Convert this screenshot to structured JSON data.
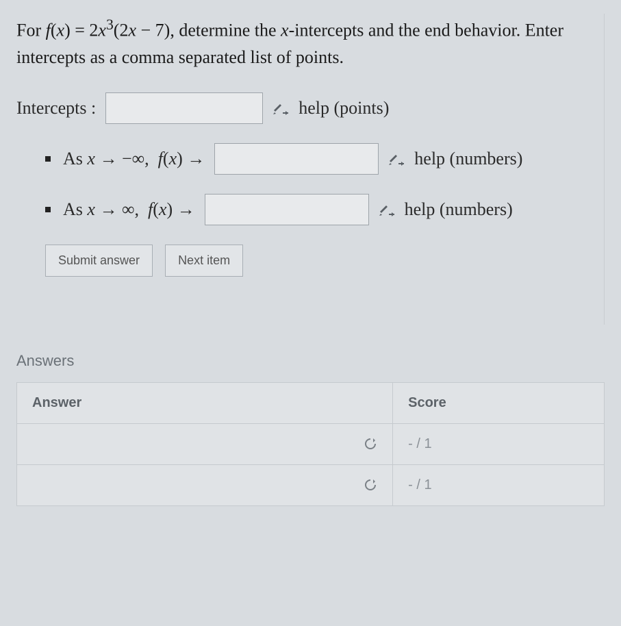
{
  "question": {
    "prefix": "For ",
    "fn_def": "f(x) = 2x³(2x − 7)",
    "middle": ", determine the ",
    "var": "x",
    "suffix1": "-intercepts and the end behavior. Enter intercepts as a comma separated list of points."
  },
  "intercepts": {
    "label": "Intercepts :",
    "value": "",
    "help": "help (points)"
  },
  "end_behavior": [
    {
      "label": "As x → −∞,  f(x) →",
      "value": "",
      "help": "help (numbers)"
    },
    {
      "label": "As x → ∞,  f(x) →",
      "value": "",
      "help": "help (numbers)"
    }
  ],
  "buttons": {
    "submit": "Submit answer",
    "next": "Next item"
  },
  "answers_section": {
    "heading": "Answers",
    "columns": {
      "answer": "Answer",
      "score": "Score"
    },
    "rows": [
      {
        "answer": "",
        "score": "- / 1"
      },
      {
        "answer": "",
        "score": "- / 1"
      }
    ]
  },
  "icons": {
    "equation_editor": "equation-editor-icon",
    "refresh": "refresh-icon"
  }
}
